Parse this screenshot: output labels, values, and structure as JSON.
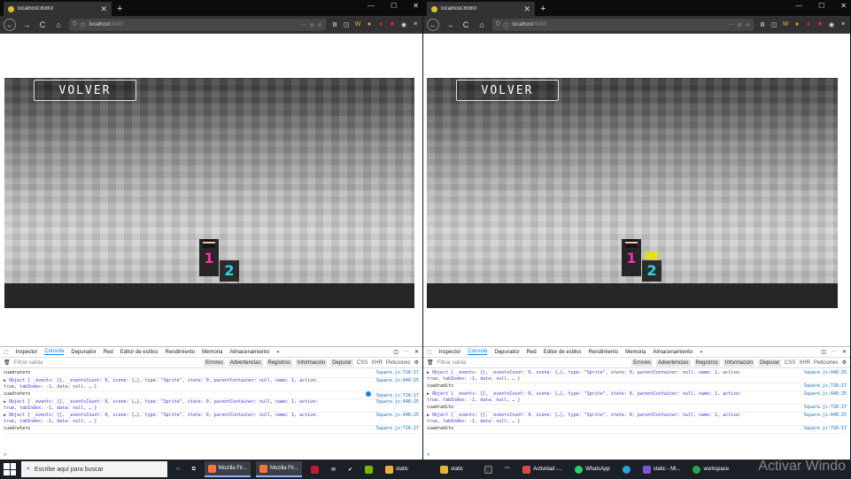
{
  "left": {
    "tab_title": "localhost:8080/",
    "new_tab": "+",
    "url_host": "localhost",
    "url_port": ":8080"
  },
  "right": {
    "tab_title": "localhost:8080/",
    "new_tab": "+",
    "url_host": "localhost",
    "url_port": ":8080"
  },
  "window_controls": {
    "minimize": "—",
    "maximize": "☐",
    "close": "✕"
  },
  "nav": {
    "back": "←",
    "forward": "→",
    "reload": "C",
    "home": "⌂",
    "more": "···",
    "menu": "≡"
  },
  "game": {
    "volver_label": "VOLVER",
    "player1": "1",
    "player2": "2"
  },
  "devtools": {
    "tabs": [
      "Inspector",
      "Consola",
      "Depurador",
      "Red",
      "Editor de estilos",
      "Rendimiento",
      "Memoria",
      "Almacenamiento",
      "»"
    ],
    "active_tab": "Consola",
    "filter_placeholder": "Filtrar salida",
    "filters": [
      "Errores",
      "Advertencias",
      "Registros",
      "Información",
      "Depurar"
    ],
    "extra_filters": [
      "CSS",
      "XHR",
      "Peticiones"
    ],
    "prompt": "»",
    "left_logs": [
      {
        "msg": "cuadratero",
        "src": "Square.js:726:17",
        "obj": false
      },
      {
        "msg": "▶ Object { _events: {}, _eventsCount: 0, scene: {…}, type: \"Sprite\", state: 0, parentContainer: null, name: 1, active: true, tabIndex: -1, data: null, … }",
        "src": "Square.js:446:25",
        "obj": true
      },
      {
        "msg": "cuadratero",
        "src": "Square.js:726:17",
        "obj": false
      },
      {
        "msg": "▶ Object { _events: {}, _eventsCount: 0, scene: {…}, type: \"Sprite\", state: 0, parentContainer: null, name: 1, active: true, tabIndex: -1, data: null, … }",
        "src": "Square.js:446:25",
        "obj": true
      },
      {
        "msg": "▶ Object { _events: {}, _eventsCount: 0, scene: {…}, type: \"Sprite\", state: 0, parentContainer: null, name: 1, active: true, tabIndex: -1, data: null, … }",
        "src": "Square.js:446:25",
        "obj": true
      },
      {
        "msg": "cuadratero",
        "src": "Square.js:726:17",
        "obj": false
      }
    ],
    "right_logs": [
      {
        "msg": "▶ Object { _events: {}, _eventsCount: 0, scene: {…}, type: \"Sprite\", state: 0, parentContainer: null, name: 1, active: true, tabIndex: -1, data: null, … }",
        "src": "Square.js:446:25",
        "obj": true
      },
      {
        "msg": "cuadradito",
        "src": "Square.js:726:17",
        "obj": false
      },
      {
        "msg": "▶ Object { _events: {}, _eventsCount: 0, scene: {…}, type: \"Sprite\", state: 0, parentContainer: null, name: 1, active: true, tabIndex: -1, data: null, … }",
        "src": "Square.js:446:25",
        "obj": true
      },
      {
        "msg": "cuadradito",
        "src": "Square.js:726:17",
        "obj": false
      },
      {
        "msg": "▶ Object { _events: {}, _eventsCount: 0, scene: {…}, type: \"Sprite\", state: 0, parentContainer: null, name: 1, active: true, tabIndex: -1, data: null, … }",
        "src": "Square.js:446:25",
        "obj": true
      },
      {
        "msg": "cuadradito",
        "src": "Square.js:726:17",
        "obj": false
      }
    ]
  },
  "taskbar": {
    "search_placeholder": "Escribe aquí para buscar",
    "items": [
      {
        "label": "Mozilla Fir...",
        "color": "#ff7139"
      },
      {
        "label": "Mozilla Fir...",
        "color": "#ff7139"
      },
      {
        "label": "static",
        "color": "#e8b23a"
      },
      {
        "label": "static",
        "color": "#e8b23a"
      },
      {
        "label": "Actividad -...",
        "color": "#d84a4a"
      },
      {
        "label": "WhatsApp",
        "color": "#25d366"
      },
      {
        "label": "static - Mi...",
        "color": "#7b55d6"
      },
      {
        "label": "workspace",
        "color": "#2aa84a"
      }
    ]
  },
  "watermark": "Activar Windo"
}
